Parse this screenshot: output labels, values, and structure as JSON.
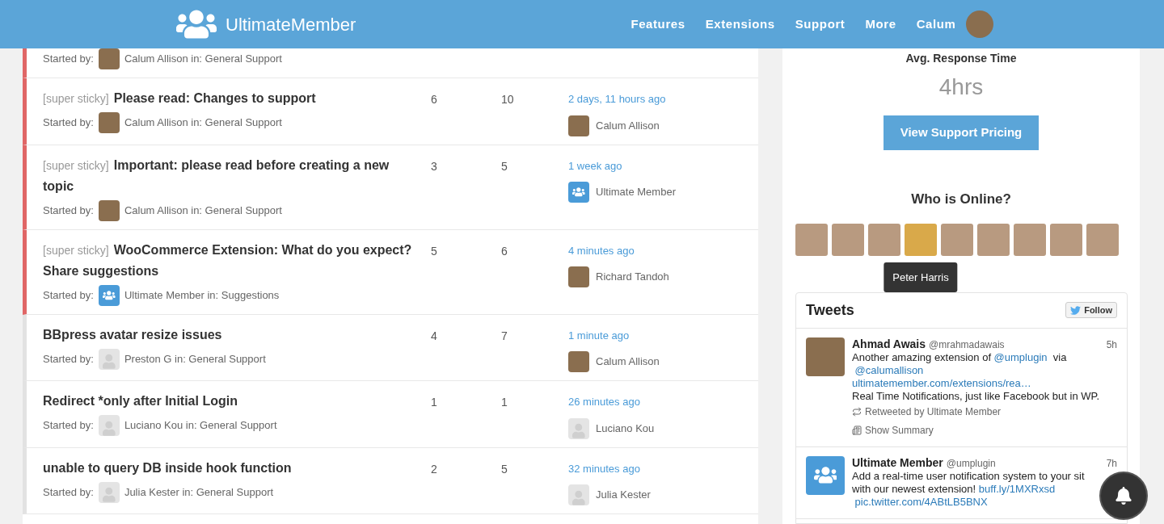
{
  "header": {
    "logo_text": "UltimateMember",
    "nav": [
      "Features",
      "Extensions",
      "Support",
      "More",
      "Calum"
    ]
  },
  "topics": [
    {
      "sticky": true,
      "started_by": "Started by:",
      "starter": "Calum Allison in: General Support",
      "starter_avatar": {
        "kind": "photo"
      }
    },
    {
      "sticky": true,
      "label": "[super sticky]",
      "title": "Please read: Changes to support",
      "started_by": "Started by:",
      "starter": "Calum Allison in: General Support",
      "starter_avatar": {
        "kind": "photo"
      },
      "voices": "6",
      "posts": "10",
      "freshness": "2 days, 11 hours ago",
      "last_poster": "Calum Allison",
      "last_avatar": {
        "kind": "photo"
      }
    },
    {
      "sticky": true,
      "label": "[super sticky]",
      "title": "Important: please read before creating a new topic",
      "started_by": "Started by:",
      "starter": "Calum Allison in: General Support",
      "starter_avatar": {
        "kind": "photo"
      },
      "voices": "3",
      "posts": "5",
      "freshness": "1 week ago",
      "last_poster": "Ultimate Member",
      "last_avatar": {
        "kind": "logo"
      }
    },
    {
      "sticky": true,
      "label": "[super sticky]",
      "title": "WooCommerce Extension: What do you expect? Share suggestions",
      "started_by": "Started by:",
      "starter": "Ultimate Member in: Suggestions",
      "starter_avatar": {
        "kind": "logo"
      },
      "voices": "5",
      "posts": "6",
      "freshness": "4 minutes ago",
      "last_poster": "Richard Tandoh",
      "last_avatar": {
        "kind": "photo"
      }
    },
    {
      "sticky": false,
      "title": "BBpress avatar resize issues",
      "started_by": "Started by:",
      "starter": "Preston G in: General Support",
      "starter_avatar": {
        "kind": "default"
      },
      "voices": "4",
      "posts": "7",
      "freshness": "1 minute ago",
      "last_poster": "Calum Allison",
      "last_avatar": {
        "kind": "photo"
      }
    },
    {
      "sticky": false,
      "title": "Redirect *only after Initial Login",
      "started_by": "Started by:",
      "starter": "Luciano Kou in: General Support",
      "starter_avatar": {
        "kind": "default"
      },
      "voices": "1",
      "posts": "1",
      "freshness": "26 minutes ago",
      "last_poster": "Luciano Kou",
      "last_avatar": {
        "kind": "default"
      }
    },
    {
      "sticky": false,
      "title": "unable to query DB inside hook function",
      "started_by": "Started by:",
      "starter": "Julia Kester in: General Support",
      "starter_avatar": {
        "kind": "default"
      },
      "voices": "2",
      "posts": "5",
      "freshness": "32 minutes ago",
      "last_poster": "Julia Kester",
      "last_avatar": {
        "kind": "default"
      }
    }
  ],
  "priority": {
    "response_label": "Avg. Response Time",
    "response_value": "4hrs",
    "button": "View Support Pricing"
  },
  "online": {
    "title": "Who is Online?",
    "tooltip": "Peter Harris",
    "users": [
      {
        "selected": false
      },
      {
        "selected": false
      },
      {
        "selected": false
      },
      {
        "selected": true
      },
      {
        "selected": false
      },
      {
        "selected": false
      },
      {
        "selected": false
      },
      {
        "selected": false
      },
      {
        "selected": false
      }
    ]
  },
  "tweets": {
    "title": "Tweets",
    "follow": "Follow",
    "items": [
      {
        "name": "Ahmad Awais",
        "handle": "@mrahmadawais",
        "time": "5h",
        "avatar": {
          "kind": "photo"
        },
        "lines": [
          [
            {
              "kind": "plain",
              "text": "Another amazing extension of "
            },
            {
              "kind": "link",
              "text": "@umplugin"
            },
            {
              "kind": "plain",
              "text": "  via"
            }
          ],
          [
            {
              "kind": "link",
              "text": " @calumallison"
            }
          ],
          [
            {
              "kind": "link",
              "text": "ultimatemember.com/extensions/rea…"
            }
          ],
          [
            {
              "kind": "plain",
              "text": "Real Time Notifications, just like Facebook but in WP."
            }
          ]
        ],
        "retweet": "Retweeted by Ultimate Member",
        "summary": "Show Summary"
      },
      {
        "name": "Ultimate Member",
        "handle": "@umplugin",
        "time": "7h",
        "avatar": {
          "kind": "logo"
        },
        "lines": [
          [
            {
              "kind": "plain",
              "text": "Add a real-time user notification system to your sit"
            }
          ],
          [
            {
              "kind": "plain",
              "text": "with our newest extension! "
            },
            {
              "kind": "link",
              "text": "buff.ly/1MXRxsd"
            }
          ],
          [
            {
              "kind": "link",
              "text": " pic.twitter.com/4ABtLB5BNX"
            }
          ]
        ]
      }
    ]
  }
}
